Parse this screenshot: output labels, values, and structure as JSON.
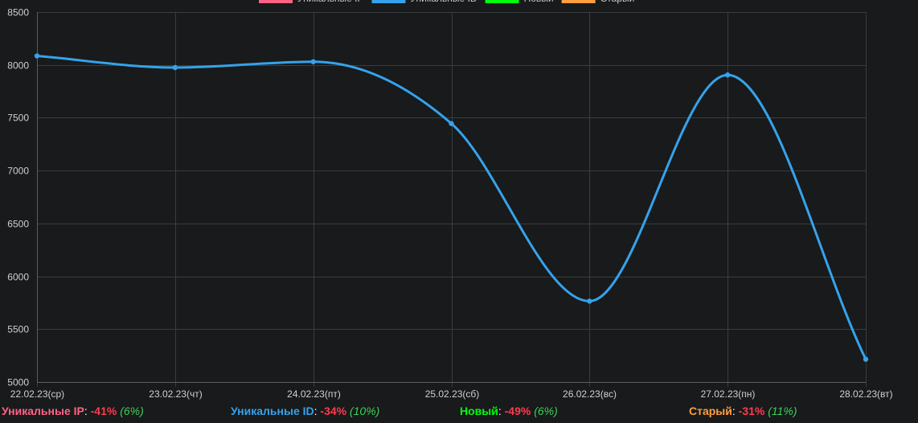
{
  "chart_data": {
    "type": "line",
    "legend": [
      {
        "name": "Уникальные IP",
        "color": "#ff6384"
      },
      {
        "name": "Уникальные ID",
        "color": "#36a2eb"
      },
      {
        "name": "Новый",
        "color": "#00ff0c"
      },
      {
        "name": "Старый",
        "color": "#ff9f40"
      }
    ],
    "legend_position": "top",
    "categories": [
      "22.02.23(ср)",
      "23.02.23(чт)",
      "24.02.23(пт)",
      "25.02.23(сб)",
      "26.02.23(вс)",
      "27.02.23(пн)",
      "28.02.23(вт)"
    ],
    "series": [
      {
        "name": "Уникальные ID",
        "color": "#36a2eb",
        "values": [
          8085,
          7975,
          8030,
          7445,
          5765,
          7905,
          5215
        ]
      }
    ],
    "yticks": [
      5000,
      5500,
      6000,
      6500,
      7000,
      7500,
      8000,
      8500
    ],
    "ylim": [
      5000,
      8500
    ],
    "grid": true
  },
  "stats": [
    {
      "name": "Уникальные IP",
      "separator": ":",
      "change": "-41%",
      "share": "(6%)",
      "color": "#ff6384"
    },
    {
      "name": "Уникальные ID",
      "separator": ":",
      "change": "-34%",
      "share": "(10%)",
      "color": "#36a2eb"
    },
    {
      "name": "Новый",
      "separator": ":",
      "change": "-49%",
      "share": "(6%)",
      "color": "#00ff0c"
    },
    {
      "name": "Старый",
      "separator": ":",
      "change": "-31%",
      "share": "(11%)",
      "color": "#ff9f40"
    }
  ]
}
